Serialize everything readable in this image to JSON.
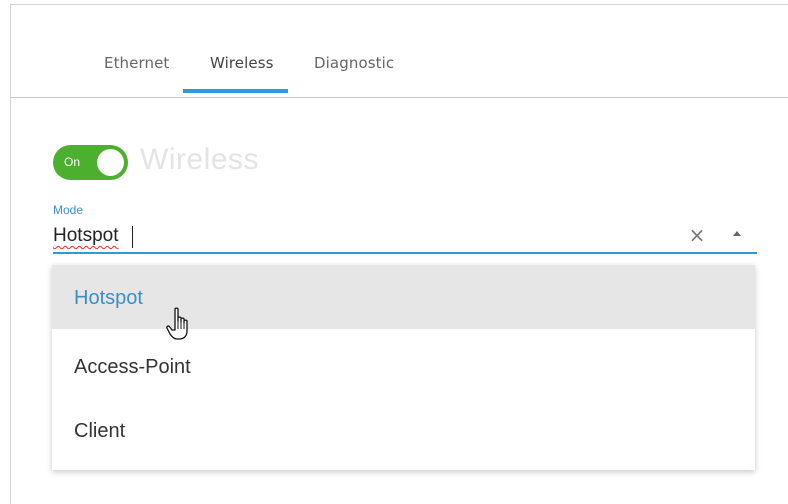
{
  "tabs": [
    {
      "label": "Ethernet",
      "active": false
    },
    {
      "label": "Wireless",
      "active": true
    },
    {
      "label": "Diagnostic",
      "active": false
    }
  ],
  "wireless": {
    "toggle_label": "On",
    "toggle_state": true,
    "title": "Wireless"
  },
  "mode": {
    "label": "Mode",
    "value": "Hotspot",
    "clear_icon": "close-icon",
    "arrow_icon": "chevron-up-icon"
  },
  "dropdown": {
    "options": [
      {
        "label": "Hotspot",
        "highlighted": true
      },
      {
        "label": "Access-Point",
        "highlighted": false
      },
      {
        "label": "Client",
        "highlighted": false
      }
    ]
  },
  "colors": {
    "accent": "#2d9bd8",
    "toggle_on": "#4caf2e",
    "highlight_bg": "#e6e6e6"
  }
}
